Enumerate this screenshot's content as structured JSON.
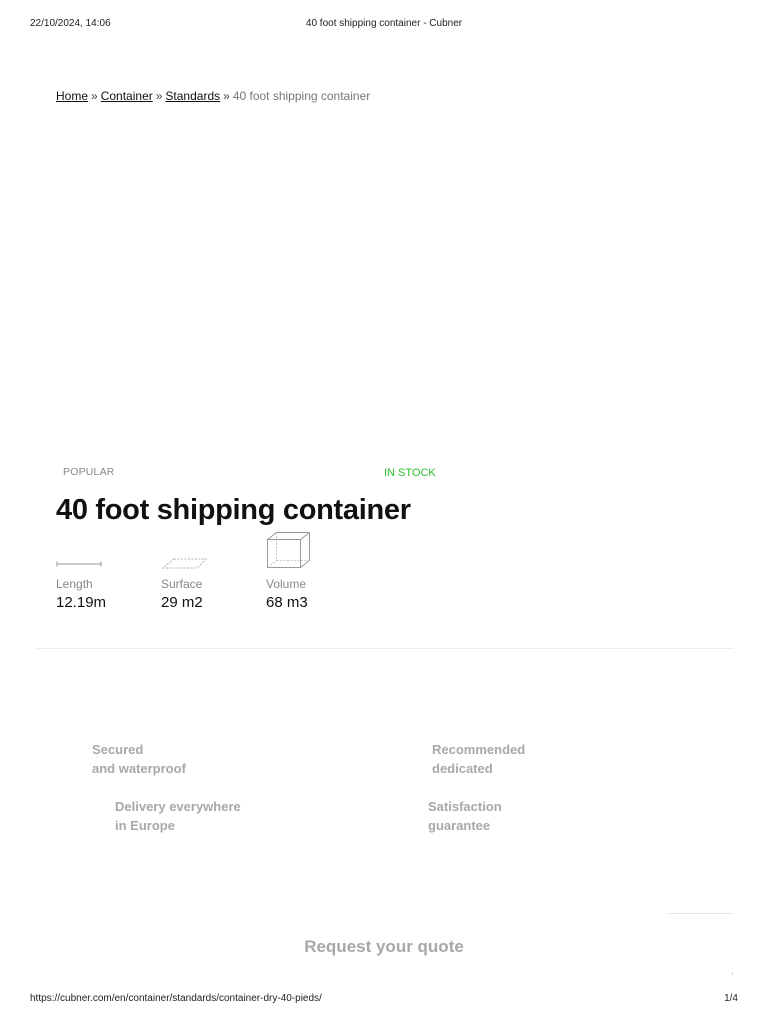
{
  "print_header": {
    "date": "22/10/2024, 14:06",
    "title": "40 foot shipping container - Cubner"
  },
  "breadcrumb": {
    "home": "Home",
    "container": "Container",
    "standards": "Standards",
    "separator": "»",
    "current": "40 foot shipping container"
  },
  "product": {
    "badge": "POPULAR",
    "stock": "IN STOCK",
    "title": "40 foot shipping container",
    "stock_color": "#2bbf2b",
    "specs": {
      "length": {
        "label": "Length",
        "value": "12.19m",
        "icon": "length-arrow-icon"
      },
      "surface": {
        "label": "Surface",
        "value": "29 m2",
        "icon": "surface-plane-icon"
      },
      "volume": {
        "label": "Volume",
        "value": "68 m3",
        "icon": "volume-cube-icon"
      }
    }
  },
  "features": {
    "secured": {
      "line1": "Secured",
      "line2": "and waterproof"
    },
    "recommended": {
      "line1": "Recommended",
      "line2": "dedicated"
    },
    "delivery": {
      "line1": "Delivery everywhere",
      "line2": "in Europe"
    },
    "satisfaction": {
      "line1": "Satisfaction",
      "line2": "guarantee"
    }
  },
  "quote": {
    "title": "Request your quote"
  },
  "print_footer": {
    "url": "https://cubner.com/en/container/standards/container-dry-40-pieds/",
    "page": "1/4"
  }
}
